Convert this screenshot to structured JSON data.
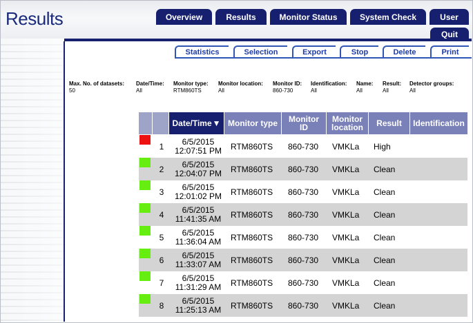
{
  "app": {
    "title": "Results"
  },
  "nav": {
    "tabs": [
      "Overview",
      "Results",
      "Monitor Status",
      "System Check",
      "User"
    ],
    "quit": "Quit"
  },
  "actions": [
    "Statistics",
    "Selection",
    "Export",
    "Stop",
    "Delete",
    "Print"
  ],
  "filters": [
    {
      "label": "Max. No. of datasets:",
      "value": "50"
    },
    {
      "label": "Date/Time:",
      "value": "All"
    },
    {
      "label": "Monitor type:",
      "value": "RTM860TS"
    },
    {
      "label": "Monitor location:",
      "value": "All"
    },
    {
      "label": "Monitor ID:",
      "value": "860-730"
    },
    {
      "label": "Identification:",
      "value": "All"
    },
    {
      "label": "Name:",
      "value": "All"
    },
    {
      "label": "Result:",
      "value": "All"
    },
    {
      "label": "Detector groups:",
      "value": "All"
    }
  ],
  "table": {
    "headers": {
      "datetime": "Date/Time",
      "sort_icon": "▼",
      "monitor_type": "Monitor type",
      "monitor_id_1": "Monitor",
      "monitor_id_2": "ID",
      "monitor_loc_1": "Monitor",
      "monitor_loc_2": "location",
      "result": "Result",
      "identification": "Identification"
    },
    "status_colors": {
      "high": "#ee1111",
      "clean": "#66ee11"
    },
    "rows": [
      {
        "n": "1",
        "date": "6/5/2015",
        "time": "12:07:51 PM",
        "type": "RTM860TS",
        "id": "860-730",
        "loc": "VMKLa",
        "result": "High",
        "ident": "",
        "status": "high"
      },
      {
        "n": "2",
        "date": "6/5/2015",
        "time": "12:04:07 PM",
        "type": "RTM860TS",
        "id": "860-730",
        "loc": "VMKLa",
        "result": "Clean",
        "ident": "",
        "status": "clean"
      },
      {
        "n": "3",
        "date": "6/5/2015",
        "time": "12:01:02 PM",
        "type": "RTM860TS",
        "id": "860-730",
        "loc": "VMKLa",
        "result": "Clean",
        "ident": "",
        "status": "clean"
      },
      {
        "n": "4",
        "date": "6/5/2015",
        "time": "11:41:35 AM",
        "type": "RTM860TS",
        "id": "860-730",
        "loc": "VMKLa",
        "result": "Clean",
        "ident": "",
        "status": "clean"
      },
      {
        "n": "5",
        "date": "6/5/2015",
        "time": "11:36:04 AM",
        "type": "RTM860TS",
        "id": "860-730",
        "loc": "VMKLa",
        "result": "Clean",
        "ident": "",
        "status": "clean"
      },
      {
        "n": "6",
        "date": "6/5/2015",
        "time": "11:33:07 AM",
        "type": "RTM860TS",
        "id": "860-730",
        "loc": "VMKLa",
        "result": "Clean",
        "ident": "",
        "status": "clean"
      },
      {
        "n": "7",
        "date": "6/5/2015",
        "time": "11:31:29 AM",
        "type": "RTM860TS",
        "id": "860-730",
        "loc": "VMKLa",
        "result": "Clean",
        "ident": "",
        "status": "clean"
      },
      {
        "n": "8",
        "date": "6/5/2015",
        "time": "11:25:13 AM",
        "type": "RTM860TS",
        "id": "860-730",
        "loc": "VMKLa",
        "result": "Clean",
        "ident": "",
        "status": "clean"
      }
    ]
  }
}
